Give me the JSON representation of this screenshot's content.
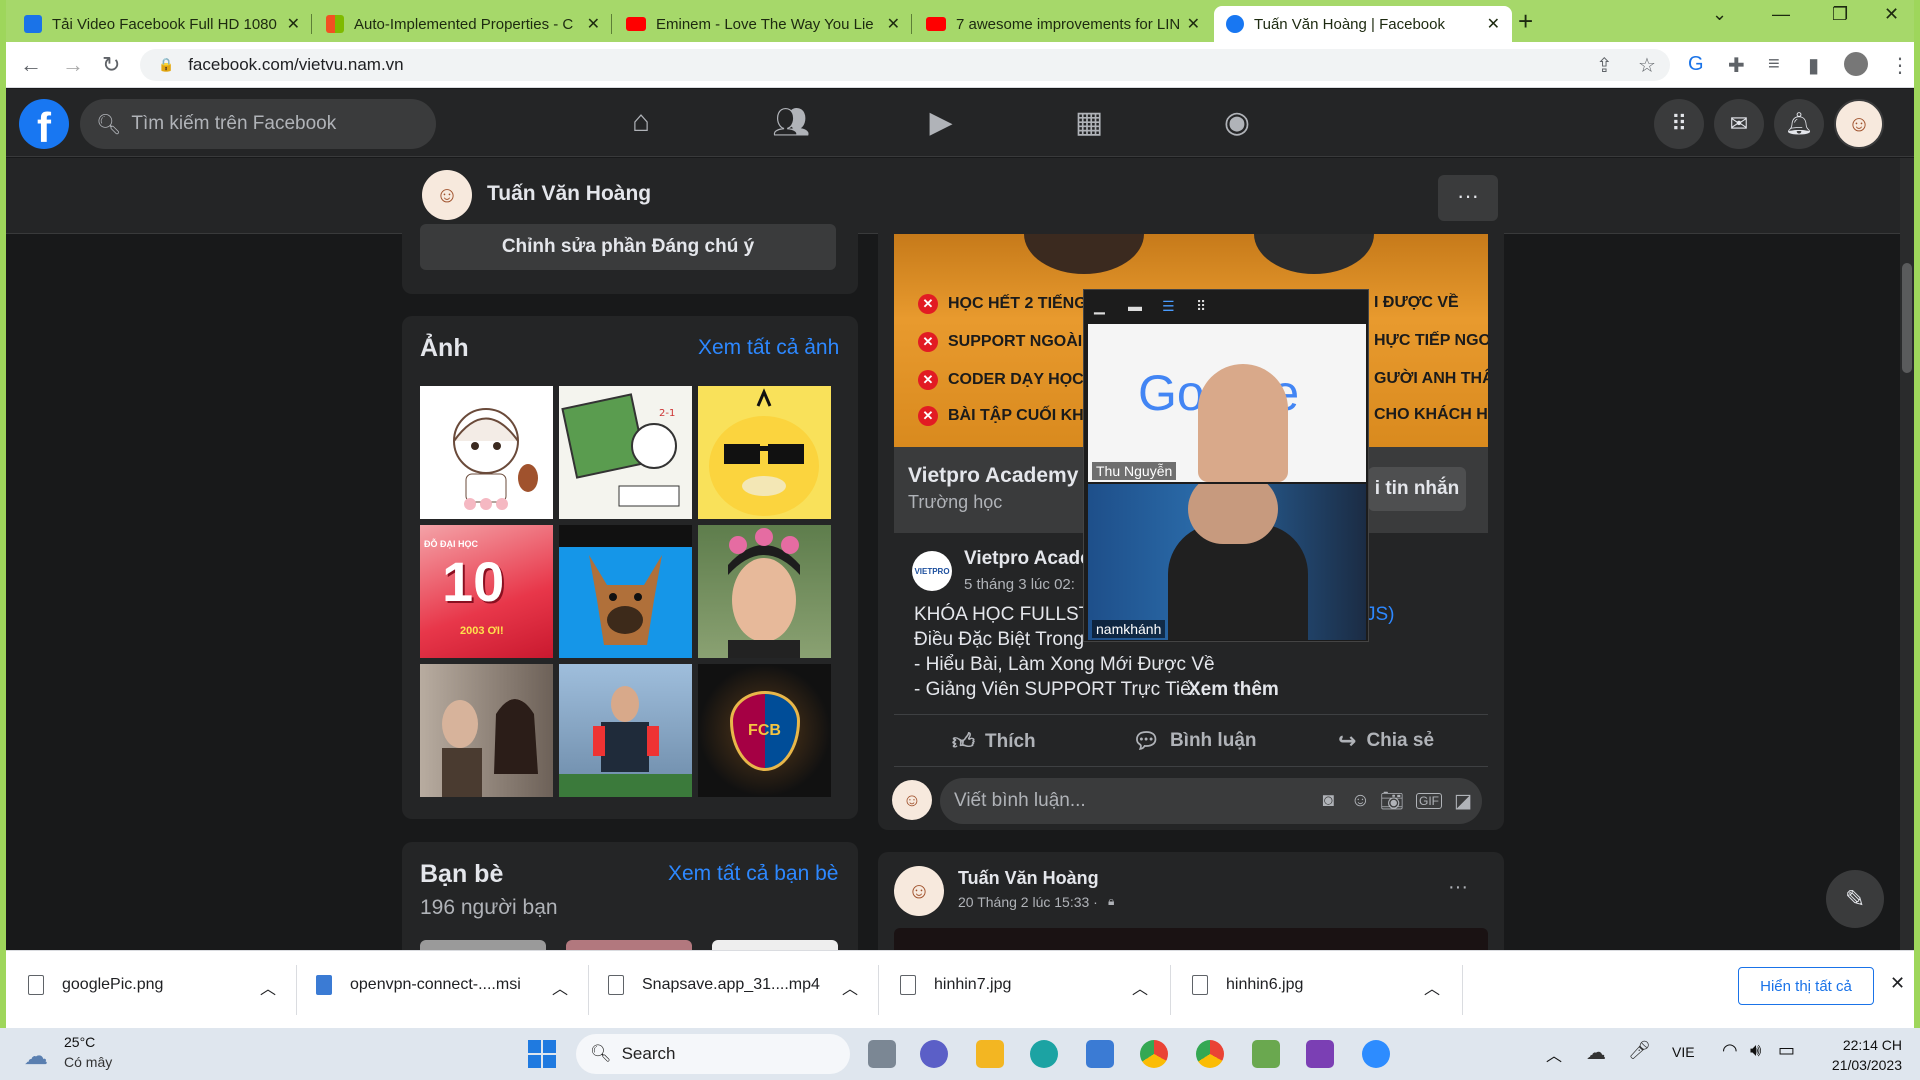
{
  "browser": {
    "tabs": [
      {
        "title": "Tải Video Facebook Full HD 1080",
        "favicon": "download-icon",
        "color": "#1a73e8"
      },
      {
        "title": "Auto-Implemented Properties - C",
        "favicon": "microsoft-icon",
        "color": "#f25022"
      },
      {
        "title": "Eminem - Love The Way You Lie",
        "favicon": "youtube-icon",
        "color": "#ff0000"
      },
      {
        "title": "7 awesome improvements for LIN",
        "favicon": "youtube-icon",
        "color": "#ff0000"
      },
      {
        "title": "Tuấn Văn Hoàng | Facebook",
        "favicon": "facebook-icon",
        "color": "#1877f2",
        "active": true
      }
    ],
    "url": "facebook.com/vietvu.nam.vn"
  },
  "facebook": {
    "search_placeholder": "Tìm kiếm trên Facebook",
    "profile_name": "Tuấn Văn Hoàng",
    "more_label": "···",
    "featured_button": "Chỉnh sửa phần Đáng chú ý",
    "photos": {
      "title": "Ảnh",
      "see_all": "Xem tất cả ảnh",
      "items": [
        {
          "desc": "anime-girl-sticker",
          "bg": "#ffffff"
        },
        {
          "desc": "cartoon-teacher-board",
          "bg": "#f4f4ee"
        },
        {
          "desc": "psyduck-sunglasses",
          "bg": "#f9e15a"
        },
        {
          "desc": "exam-10-poster",
          "bg": "#e8374a",
          "text": "10",
          "badge": "ĐỖ ĐẠI HỌC",
          "sub": "2003 ƠI!"
        },
        {
          "desc": "dog-photo",
          "bg": "#1596e8"
        },
        {
          "desc": "man-flower-crown",
          "bg": "#6a8a55"
        },
        {
          "desc": "drama-couple",
          "bg": "#9a8f84"
        },
        {
          "desc": "football-keeper",
          "bg": "#7fa3c9"
        },
        {
          "desc": "fc-barcelona-logo",
          "bg": "#111111",
          "text": "FCB"
        }
      ]
    },
    "friends": {
      "title": "Bạn bè",
      "see_all": "Xem tất cả bạn bè",
      "count": "196 người bạn"
    },
    "page_card": {
      "banner_items": [
        "HỌC HẾT 2 TIẾNG RỒI V",
        "SUPPORT NGOÀI GIỜ T",
        "CODER DẠY HỌC",
        "BÀI TẬP CUỐI KHÓA"
      ],
      "banner_right": [
        "I ĐƯỢC VỀ",
        "HỰC TIẾP NGOÀI GIỜ",
        "GƯỜI ANH THÂN THI",
        "CHO KHÁCH HÀNG"
      ],
      "name": "Vietpro Academy",
      "category": "Trường học",
      "message_button": "i tin nhắn"
    },
    "post": {
      "author": "Vietpro Acade",
      "time": "5 tháng 3 lúc 02:",
      "page_logo": "VIETPRO",
      "lines": [
        "KHÓA HỌC FULLSTA",
        "Điều Đặc Biệt Trong",
        "- Hiểu Bài, Làm Xong Mới Được Về",
        "- Giảng Viên SUPPORT Trực Tiế..."
      ],
      "line1_tail": "JS)",
      "see_more": "Xem thêm",
      "like": "Thích",
      "comment": "Bình luận",
      "share": "Chia sẻ",
      "comment_placeholder": "Viết bình luận..."
    },
    "post2": {
      "author": "Tuấn Văn Hoàng",
      "time": "20 Tháng 2 lúc 15:33 ·",
      "more_label": "···"
    }
  },
  "video_call": {
    "participants": [
      {
        "name": "Thu Nguyễn",
        "backdrop_text": "Google"
      },
      {
        "name": "namkhánh"
      }
    ]
  },
  "downloads": {
    "items": [
      "googlePic.png",
      "openvpn-connect-....msi",
      "Snapsave.app_31....mp4",
      "hinhin7.jpg",
      "hinhin6.jpg"
    ],
    "show_all": "Hiển thị tất cả"
  },
  "taskbar": {
    "weather_temp": "25°C",
    "weather_desc": "Có mây",
    "search_label": "Search",
    "language": "VIE",
    "time": "22:14 CH",
    "date": "21/03/2023"
  }
}
